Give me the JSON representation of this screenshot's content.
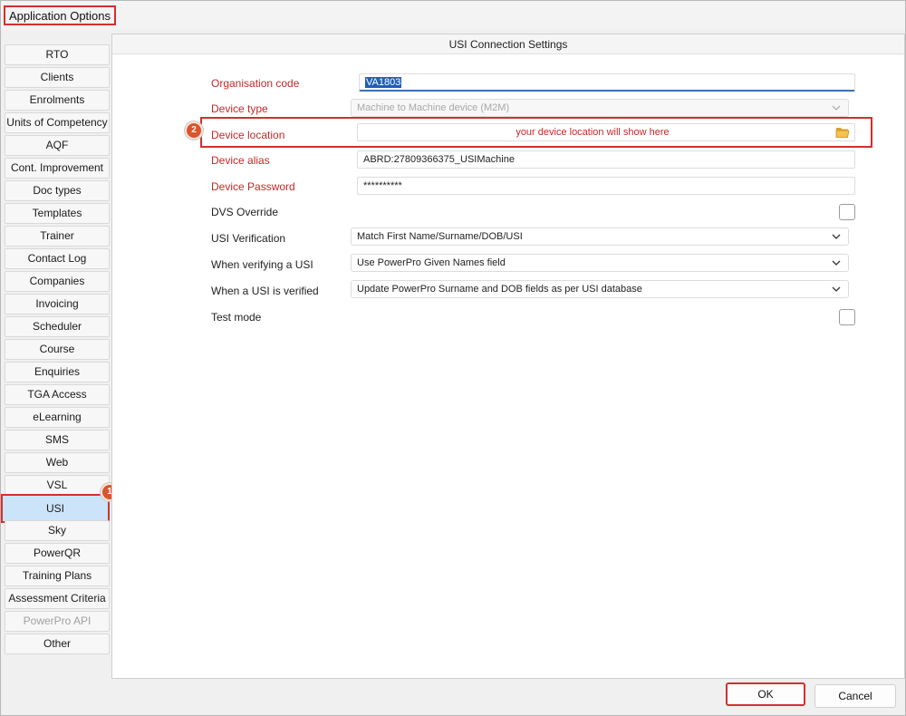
{
  "window": {
    "title": "Application Options"
  },
  "sidebar": {
    "items": [
      {
        "label": "RTO",
        "state": "normal"
      },
      {
        "label": "Clients",
        "state": "normal"
      },
      {
        "label": "Enrolments",
        "state": "normal"
      },
      {
        "label": "Units of Competency",
        "state": "normal"
      },
      {
        "label": "AQF",
        "state": "normal"
      },
      {
        "label": "Cont. Improvement",
        "state": "normal"
      },
      {
        "label": "Doc types",
        "state": "normal"
      },
      {
        "label": "Templates",
        "state": "normal"
      },
      {
        "label": "Trainer",
        "state": "normal"
      },
      {
        "label": "Contact Log",
        "state": "normal"
      },
      {
        "label": "Companies",
        "state": "normal"
      },
      {
        "label": "Invoicing",
        "state": "normal"
      },
      {
        "label": "Scheduler",
        "state": "normal"
      },
      {
        "label": "Course",
        "state": "normal"
      },
      {
        "label": "Enquiries",
        "state": "normal"
      },
      {
        "label": "TGA Access",
        "state": "normal"
      },
      {
        "label": "eLearning",
        "state": "normal"
      },
      {
        "label": "SMS",
        "state": "normal"
      },
      {
        "label": "Web",
        "state": "normal"
      },
      {
        "label": "VSL",
        "state": "normal"
      },
      {
        "label": "USI",
        "state": "selected"
      },
      {
        "label": "Sky",
        "state": "normal"
      },
      {
        "label": "PowerQR",
        "state": "normal"
      },
      {
        "label": "Training Plans",
        "state": "normal"
      },
      {
        "label": "Assessment Criteria",
        "state": "normal"
      },
      {
        "label": "PowerPro API",
        "state": "disabled"
      },
      {
        "label": "Other",
        "state": "normal"
      }
    ],
    "badge_usi": "1"
  },
  "panel": {
    "header": "USI Connection Settings",
    "fields": {
      "organisation_code": {
        "label": "Organisation code",
        "value": "VA1803"
      },
      "device_type": {
        "label": "Device type",
        "value": "Machine to Machine device (M2M)"
      },
      "device_location": {
        "label": "Device location",
        "value": "your device location will show here",
        "badge": "2"
      },
      "device_alias": {
        "label": "Device alias",
        "value": "ABRD:27809366375_USIMachine"
      },
      "device_password": {
        "label": "Device Password",
        "value": "**********"
      },
      "dvs_override": {
        "label": "DVS Override",
        "checked": false
      },
      "usi_verification": {
        "label": "USI Verification",
        "value": "Match First Name/Surname/DOB/USI"
      },
      "when_verifying": {
        "label": "When verifying a USI",
        "value": "Use PowerPro Given Names field"
      },
      "when_verified": {
        "label": "When a USI is verified",
        "value": "Update PowerPro Surname and DOB fields as per USI database"
      },
      "test_mode": {
        "label": "Test mode",
        "checked": false
      }
    }
  },
  "footer": {
    "ok_label": "OK",
    "cancel_label": "Cancel"
  },
  "colors": {
    "highlight": "#d32f2f",
    "required_label": "#c62828",
    "badge": "#d9552c",
    "selected_nav": "#cce4fa"
  },
  "icons": [
    "chevron-down-icon",
    "folder-open-icon"
  ]
}
